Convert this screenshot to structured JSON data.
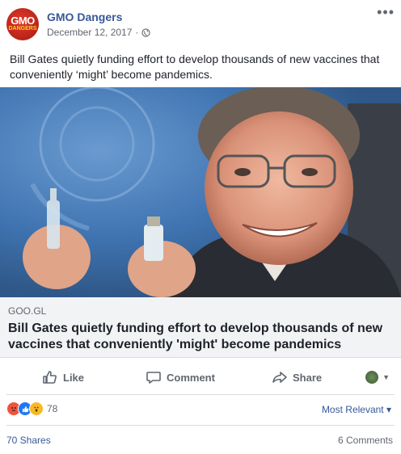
{
  "post": {
    "page_name": "GMO Dangers",
    "avatar_text_top": "GMO",
    "avatar_text_bottom": "DANGERS",
    "date": "December 12, 2017",
    "separator": "·",
    "privacy_icon": "globe-icon",
    "more_icon": "more-options-icon",
    "text": "Bill Gates quietly funding effort to develop thousands of new vaccines that conveniently ‘might’ become pandemics."
  },
  "link": {
    "domain": "GOO.GL",
    "title": "Bill Gates quietly funding effort to develop thousands of new vaccines that conveniently 'might' become pandemics"
  },
  "actions": {
    "like": "Like",
    "comment": "Comment",
    "share": "Share"
  },
  "stats": {
    "reactions": [
      {
        "icon": "angry-reaction-icon",
        "color": "#f0533c"
      },
      {
        "icon": "like-reaction-icon",
        "color": "#2078f4"
      },
      {
        "icon": "wow-reaction-icon",
        "color": "#f7b928"
      }
    ],
    "reaction_count": "78",
    "sort_label": "Most Relevant ▾",
    "shares": "70 Shares",
    "comments": "6 Comments"
  },
  "colors": {
    "link_blue": "#385898",
    "meta_gray": "#616770",
    "link_box_bg": "#f2f3f5"
  }
}
